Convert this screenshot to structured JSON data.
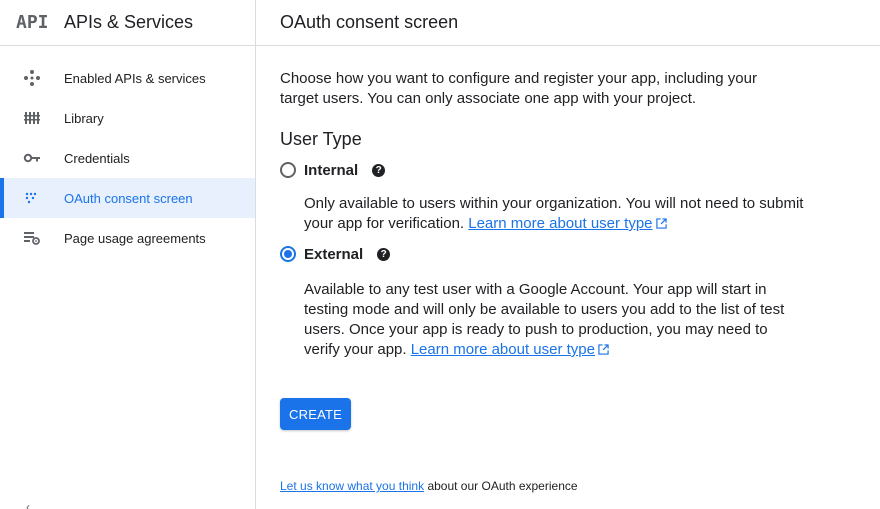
{
  "sidebar": {
    "logo": "API",
    "title": "APIs & Services",
    "items": [
      {
        "label": "Enabled APIs & services",
        "icon": "diamond-dots-icon"
      },
      {
        "label": "Library",
        "icon": "library-icon"
      },
      {
        "label": "Credentials",
        "icon": "key-icon"
      },
      {
        "label": "OAuth consent screen",
        "icon": "consent-dots-icon",
        "active": true
      },
      {
        "label": "Page usage agreements",
        "icon": "settings-list-icon"
      }
    ],
    "collapse_icon": "‹"
  },
  "main": {
    "title": "OAuth consent screen",
    "intro": "Choose how you want to configure and register your app, including your target users. You can only associate one app with your project.",
    "section_title": "User Type",
    "options": [
      {
        "label": "Internal",
        "checked": false,
        "desc": "Only available to users within your organization. You will not need to submit your app for verification.",
        "link": "Learn more about user type"
      },
      {
        "label": "External",
        "checked": true,
        "desc": "Available to any test user with a Google Account. Your app will start in testing mode and will only be available to users you add to the list of test users. Once your app is ready to push to production, you may need to verify your app.",
        "link": "Learn more about user type"
      }
    ],
    "create_label": "CREATE",
    "feedback_link": "Let us know what you think",
    "feedback_text": "about our OAuth experience"
  },
  "colors": {
    "accent": "#1a73e8",
    "active_bg": "#e8f0fe",
    "border": "#dadce0"
  }
}
